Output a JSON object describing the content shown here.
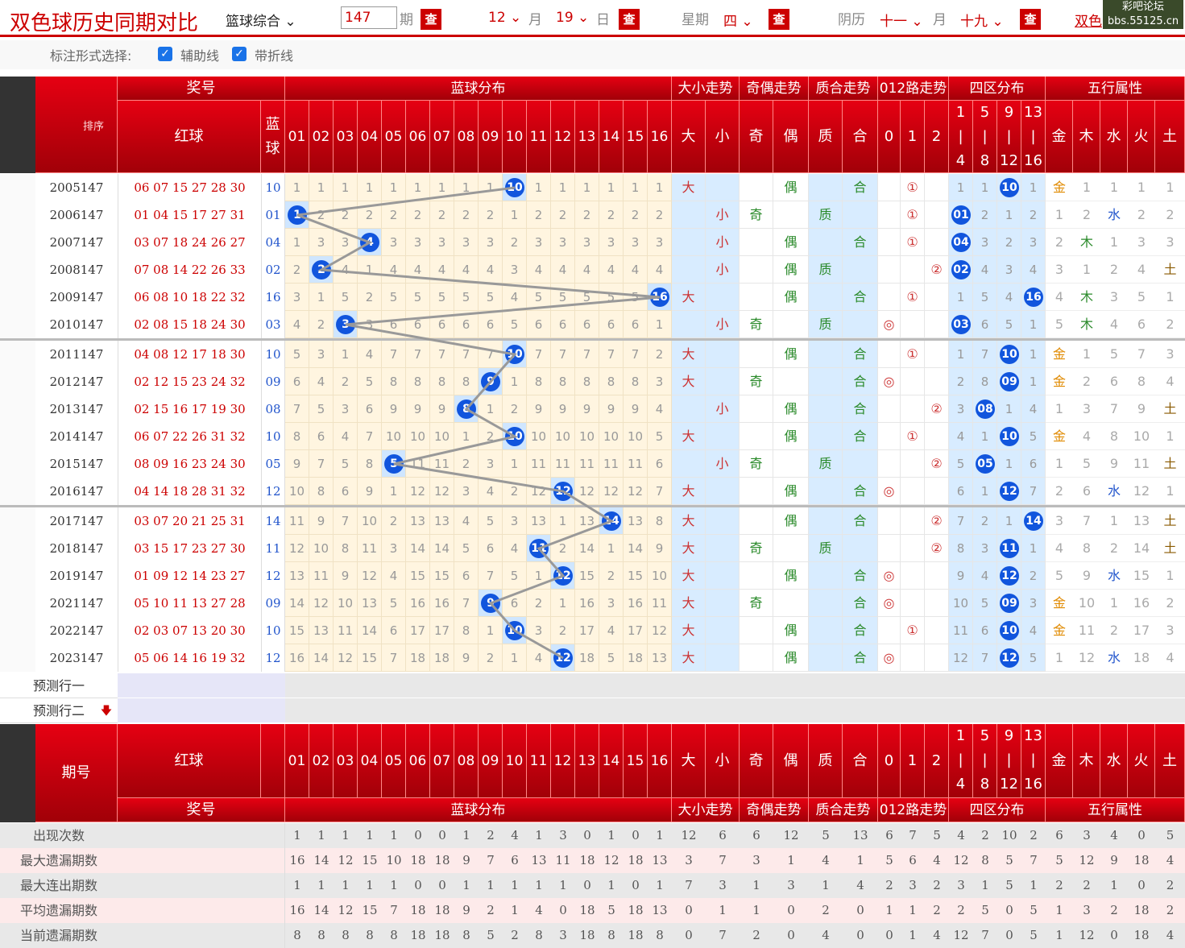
{
  "top": {
    "title": "双色球历史同期对比",
    "mode": "篮球综合",
    "issue_value": "147",
    "issue_unit": "期",
    "query": "查",
    "month": "12",
    "month_unit": "月",
    "day": "19",
    "day_unit": "日",
    "weekday_label": "星期",
    "weekday": "四",
    "lunar_label": "阴历",
    "lunar_month": "十一",
    "lunar_day": "十九",
    "site": "bbs.55125.cn",
    "brand": "彩吧论坛",
    "right_link": "双色"
  },
  "options": {
    "label": "标注形式选择:",
    "opt1": "辅助线",
    "opt2": "带折线"
  },
  "header": {
    "issue": "期号",
    "sort": "排序",
    "prize": "奖号",
    "red": "红球",
    "blue": "蓝球",
    "groups": [
      "蓝球分布",
      "大小走势",
      "奇偶走势",
      "质合走势",
      "012路走势",
      "四区分布",
      "五行属性"
    ],
    "blue_nums": [
      "01",
      "02",
      "03",
      "04",
      "05",
      "06",
      "07",
      "08",
      "09",
      "10",
      "11",
      "12",
      "13",
      "14",
      "15",
      "16"
    ],
    "dx": [
      "大",
      "小"
    ],
    "jo": [
      "奇",
      "偶"
    ],
    "zh": [
      "质",
      "合"
    ],
    "lu": [
      "0",
      "1",
      "2"
    ],
    "zone": [
      "1|4",
      "5|8",
      "9|12",
      "13|16"
    ],
    "wx": [
      "金",
      "木",
      "水",
      "火",
      "土"
    ]
  },
  "rows": [
    {
      "issue": "2005147",
      "red": "06 07 15 27 28 30",
      "blue": "10",
      "dist": [
        "1",
        "1",
        "1",
        "1",
        "1",
        "1",
        "1",
        "1",
        "1",
        "10",
        "1",
        "1",
        "1",
        "1",
        "1",
        "1"
      ],
      "dx": [
        "大",
        ""
      ],
      "jo": [
        "",
        "偶"
      ],
      "zh": [
        "",
        "合"
      ],
      "lu": [
        "",
        "①",
        ""
      ],
      "zone": [
        "1",
        "1",
        "10",
        "1"
      ],
      "wx": [
        "金",
        "1",
        "1",
        "1",
        "1"
      ]
    },
    {
      "issue": "2006147",
      "red": "01 04 15 17 27 31",
      "blue": "01",
      "dist": [
        "1",
        "2",
        "2",
        "2",
        "2",
        "2",
        "2",
        "2",
        "2",
        "1",
        "2",
        "2",
        "2",
        "2",
        "2",
        "2"
      ],
      "dx": [
        "",
        "小"
      ],
      "jo": [
        "奇",
        ""
      ],
      "zh": [
        "质",
        ""
      ],
      "lu": [
        "",
        "①",
        ""
      ],
      "zone": [
        "01",
        "2",
        "1",
        "2"
      ],
      "wx": [
        "1",
        "2",
        "水",
        "2",
        "2"
      ]
    },
    {
      "issue": "2007147",
      "red": "03 07 18 24 26 27",
      "blue": "04",
      "dist": [
        "1",
        "3",
        "3",
        "4",
        "3",
        "3",
        "3",
        "3",
        "3",
        "2",
        "3",
        "3",
        "3",
        "3",
        "3",
        "3"
      ],
      "dx": [
        "",
        "小"
      ],
      "jo": [
        "",
        "偶"
      ],
      "zh": [
        "",
        "合"
      ],
      "lu": [
        "",
        "①",
        ""
      ],
      "zone": [
        "04",
        "3",
        "2",
        "3"
      ],
      "wx": [
        "2",
        "木",
        "1",
        "3",
        "3"
      ]
    },
    {
      "issue": "2008147",
      "red": "07 08 14 22 26 33",
      "blue": "02",
      "dist": [
        "2",
        "2",
        "4",
        "1",
        "4",
        "4",
        "4",
        "4",
        "4",
        "3",
        "4",
        "4",
        "4",
        "4",
        "4",
        "4"
      ],
      "dx": [
        "",
        "小"
      ],
      "jo": [
        "",
        "偶"
      ],
      "zh": [
        "质",
        ""
      ],
      "lu": [
        "",
        "",
        "②"
      ],
      "zone": [
        "02",
        "4",
        "3",
        "4"
      ],
      "wx": [
        "3",
        "1",
        "2",
        "4",
        "土"
      ]
    },
    {
      "issue": "2009147",
      "red": "06 08 10 18 22 32",
      "blue": "16",
      "dist": [
        "3",
        "1",
        "5",
        "2",
        "5",
        "5",
        "5",
        "5",
        "5",
        "4",
        "5",
        "5",
        "5",
        "5",
        "5",
        "16"
      ],
      "dx": [
        "大",
        ""
      ],
      "jo": [
        "",
        "偶"
      ],
      "zh": [
        "",
        "合"
      ],
      "lu": [
        "",
        "①",
        ""
      ],
      "zone": [
        "1",
        "5",
        "4",
        "16"
      ],
      "wx": [
        "4",
        "木",
        "3",
        "5",
        "1"
      ]
    },
    {
      "issue": "2010147",
      "red": "02 08 15 18 24 30",
      "blue": "03",
      "dist": [
        "4",
        "2",
        "3",
        "3",
        "6",
        "6",
        "6",
        "6",
        "6",
        "5",
        "6",
        "6",
        "6",
        "6",
        "6",
        "1"
      ],
      "dx": [
        "",
        "小"
      ],
      "jo": [
        "奇",
        ""
      ],
      "zh": [
        "质",
        ""
      ],
      "lu": [
        "◎",
        "",
        ""
      ],
      "zone": [
        "03",
        "6",
        "5",
        "1"
      ],
      "wx": [
        "5",
        "木",
        "4",
        "6",
        "2"
      ]
    },
    {
      "issue": "2011147",
      "red": "04 08 12 17 18 30",
      "blue": "10",
      "dist": [
        "5",
        "3",
        "1",
        "4",
        "7",
        "7",
        "7",
        "7",
        "7",
        "10",
        "7",
        "7",
        "7",
        "7",
        "7",
        "2"
      ],
      "dx": [
        "大",
        ""
      ],
      "jo": [
        "",
        "偶"
      ],
      "zh": [
        "",
        "合"
      ],
      "lu": [
        "",
        "①",
        ""
      ],
      "zone": [
        "1",
        "7",
        "10",
        "1"
      ],
      "wx": [
        "金",
        "1",
        "5",
        "7",
        "3"
      ]
    },
    {
      "issue": "2012147",
      "red": "02 12 15 23 24 32",
      "blue": "09",
      "dist": [
        "6",
        "4",
        "2",
        "5",
        "8",
        "8",
        "8",
        "8",
        "9",
        "1",
        "8",
        "8",
        "8",
        "8",
        "8",
        "3"
      ],
      "dx": [
        "大",
        ""
      ],
      "jo": [
        "奇",
        ""
      ],
      "zh": [
        "",
        "合"
      ],
      "lu": [
        "◎",
        "",
        ""
      ],
      "zone": [
        "2",
        "8",
        "09",
        "1"
      ],
      "wx": [
        "金",
        "2",
        "6",
        "8",
        "4"
      ]
    },
    {
      "issue": "2013147",
      "red": "02 15 16 17 19 30",
      "blue": "08",
      "dist": [
        "7",
        "5",
        "3",
        "6",
        "9",
        "9",
        "9",
        "8",
        "1",
        "2",
        "9",
        "9",
        "9",
        "9",
        "9",
        "4"
      ],
      "dx": [
        "",
        "小"
      ],
      "jo": [
        "",
        "偶"
      ],
      "zh": [
        "",
        "合"
      ],
      "lu": [
        "",
        "",
        "②"
      ],
      "zone": [
        "3",
        "08",
        "1",
        "4"
      ],
      "wx": [
        "1",
        "3",
        "7",
        "9",
        "土"
      ]
    },
    {
      "issue": "2014147",
      "red": "06 07 22 26 31 32",
      "blue": "10",
      "dist": [
        "8",
        "6",
        "4",
        "7",
        "10",
        "10",
        "10",
        "1",
        "2",
        "10",
        "10",
        "10",
        "10",
        "10",
        "10",
        "5"
      ],
      "dx": [
        "大",
        ""
      ],
      "jo": [
        "",
        "偶"
      ],
      "zh": [
        "",
        "合"
      ],
      "lu": [
        "",
        "①",
        ""
      ],
      "zone": [
        "4",
        "1",
        "10",
        "5"
      ],
      "wx": [
        "金",
        "4",
        "8",
        "10",
        "1"
      ]
    },
    {
      "issue": "2015147",
      "red": "08 09 16 23 24 30",
      "blue": "05",
      "dist": [
        "9",
        "7",
        "5",
        "8",
        "5",
        "11",
        "11",
        "2",
        "3",
        "1",
        "11",
        "11",
        "11",
        "11",
        "11",
        "6"
      ],
      "dx": [
        "",
        "小"
      ],
      "jo": [
        "奇",
        ""
      ],
      "zh": [
        "质",
        ""
      ],
      "lu": [
        "",
        "",
        "②"
      ],
      "zone": [
        "5",
        "05",
        "1",
        "6"
      ],
      "wx": [
        "1",
        "5",
        "9",
        "11",
        "土"
      ]
    },
    {
      "issue": "2016147",
      "red": "04 14 18 28 31 32",
      "blue": "12",
      "dist": [
        "10",
        "8",
        "6",
        "9",
        "1",
        "12",
        "12",
        "3",
        "4",
        "2",
        "12",
        "12",
        "12",
        "12",
        "12",
        "7"
      ],
      "dx": [
        "大",
        ""
      ],
      "jo": [
        "",
        "偶"
      ],
      "zh": [
        "",
        "合"
      ],
      "lu": [
        "◎",
        "",
        ""
      ],
      "zone": [
        "6",
        "1",
        "12",
        "7"
      ],
      "wx": [
        "2",
        "6",
        "水",
        "12",
        "1"
      ]
    },
    {
      "issue": "2017147",
      "red": "03 07 20 21 25 31",
      "blue": "14",
      "dist": [
        "11",
        "9",
        "7",
        "10",
        "2",
        "13",
        "13",
        "4",
        "5",
        "3",
        "13",
        "1",
        "13",
        "14",
        "13",
        "8"
      ],
      "dx": [
        "大",
        ""
      ],
      "jo": [
        "",
        "偶"
      ],
      "zh": [
        "",
        "合"
      ],
      "lu": [
        "",
        "",
        "②"
      ],
      "zone": [
        "7",
        "2",
        "1",
        "14"
      ],
      "wx": [
        "3",
        "7",
        "1",
        "13",
        "土"
      ]
    },
    {
      "issue": "2018147",
      "red": "03 15 17 23 27 30",
      "blue": "11",
      "dist": [
        "12",
        "10",
        "8",
        "11",
        "3",
        "14",
        "14",
        "5",
        "6",
        "4",
        "11",
        "2",
        "14",
        "1",
        "14",
        "9"
      ],
      "dx": [
        "大",
        ""
      ],
      "jo": [
        "奇",
        ""
      ],
      "zh": [
        "质",
        ""
      ],
      "lu": [
        "",
        "",
        "②"
      ],
      "zone": [
        "8",
        "3",
        "11",
        "1"
      ],
      "wx": [
        "4",
        "8",
        "2",
        "14",
        "土"
      ]
    },
    {
      "issue": "2019147",
      "red": "01 09 12 14 23 27",
      "blue": "12",
      "dist": [
        "13",
        "11",
        "9",
        "12",
        "4",
        "15",
        "15",
        "6",
        "7",
        "5",
        "1",
        "12",
        "15",
        "2",
        "15",
        "10"
      ],
      "dx": [
        "大",
        ""
      ],
      "jo": [
        "",
        "偶"
      ],
      "zh": [
        "",
        "合"
      ],
      "lu": [
        "◎",
        "",
        ""
      ],
      "zone": [
        "9",
        "4",
        "12",
        "2"
      ],
      "wx": [
        "5",
        "9",
        "水",
        "15",
        "1"
      ]
    },
    {
      "issue": "2021147",
      "red": "05 10 11 13 27 28",
      "blue": "09",
      "dist": [
        "14",
        "12",
        "10",
        "13",
        "5",
        "16",
        "16",
        "7",
        "9",
        "6",
        "2",
        "1",
        "16",
        "3",
        "16",
        "11"
      ],
      "dx": [
        "大",
        ""
      ],
      "jo": [
        "奇",
        ""
      ],
      "zh": [
        "",
        "合"
      ],
      "lu": [
        "◎",
        "",
        ""
      ],
      "zone": [
        "10",
        "5",
        "09",
        "3"
      ],
      "wx": [
        "金",
        "10",
        "1",
        "16",
        "2"
      ]
    },
    {
      "issue": "2022147",
      "red": "02 03 07 13 20 30",
      "blue": "10",
      "dist": [
        "15",
        "13",
        "11",
        "14",
        "6",
        "17",
        "17",
        "8",
        "1",
        "10",
        "3",
        "2",
        "17",
        "4",
        "17",
        "12"
      ],
      "dx": [
        "大",
        ""
      ],
      "jo": [
        "",
        "偶"
      ],
      "zh": [
        "",
        "合"
      ],
      "lu": [
        "",
        "①",
        ""
      ],
      "zone": [
        "11",
        "6",
        "10",
        "4"
      ],
      "wx": [
        "金",
        "11",
        "2",
        "17",
        "3"
      ]
    },
    {
      "issue": "2023147",
      "red": "05 06 14 16 19 32",
      "blue": "12",
      "dist": [
        "16",
        "14",
        "12",
        "15",
        "7",
        "18",
        "18",
        "9",
        "2",
        "1",
        "4",
        "12",
        "18",
        "5",
        "18",
        "13"
      ],
      "dx": [
        "大",
        ""
      ],
      "jo": [
        "",
        "偶"
      ],
      "zh": [
        "",
        "合"
      ],
      "lu": [
        "◎",
        "",
        ""
      ],
      "zone": [
        "12",
        "7",
        "12",
        "5"
      ],
      "wx": [
        "1",
        "12",
        "水",
        "18",
        "4"
      ]
    }
  ],
  "predict": [
    "预测行一",
    "预测行二"
  ],
  "stats": [
    {
      "label": "出现次数",
      "v": [
        "1",
        "1",
        "1",
        "1",
        "1",
        "0",
        "0",
        "1",
        "2",
        "4",
        "1",
        "3",
        "0",
        "1",
        "0",
        "1",
        "12",
        "6",
        "6",
        "12",
        "5",
        "13",
        "6",
        "7",
        "5",
        "4",
        "2",
        "10",
        "2",
        "6",
        "3",
        "4",
        "0",
        "5"
      ]
    },
    {
      "label": "最大遗漏期数",
      "v": [
        "16",
        "14",
        "12",
        "15",
        "10",
        "18",
        "18",
        "9",
        "7",
        "6",
        "13",
        "11",
        "18",
        "12",
        "18",
        "13",
        "3",
        "7",
        "3",
        "1",
        "4",
        "1",
        "5",
        "6",
        "4",
        "12",
        "8",
        "5",
        "7",
        "5",
        "12",
        "9",
        "18",
        "4"
      ]
    },
    {
      "label": "最大连出期数",
      "v": [
        "1",
        "1",
        "1",
        "1",
        "1",
        "0",
        "0",
        "1",
        "1",
        "1",
        "1",
        "1",
        "0",
        "1",
        "0",
        "1",
        "7",
        "3",
        "1",
        "3",
        "1",
        "4",
        "2",
        "3",
        "2",
        "3",
        "1",
        "5",
        "1",
        "2",
        "2",
        "1",
        "0",
        "2"
      ]
    },
    {
      "label": "平均遗漏期数",
      "v": [
        "16",
        "14",
        "12",
        "15",
        "7",
        "18",
        "18",
        "9",
        "2",
        "1",
        "4",
        "0",
        "18",
        "5",
        "18",
        "13",
        "0",
        "1",
        "1",
        "0",
        "2",
        "0",
        "1",
        "1",
        "2",
        "2",
        "5",
        "0",
        "5",
        "1",
        "3",
        "2",
        "18",
        "2"
      ]
    },
    {
      "label": "当前遗漏期数",
      "v": [
        "8",
        "8",
        "8",
        "8",
        "8",
        "18",
        "18",
        "8",
        "5",
        "2",
        "8",
        "3",
        "18",
        "8",
        "18",
        "8",
        "0",
        "7",
        "2",
        "0",
        "4",
        "0",
        "0",
        "1",
        "4",
        "12",
        "7",
        "0",
        "5",
        "1",
        "12",
        "0",
        "18",
        "4"
      ]
    }
  ],
  "colors": {
    "red": "#c00",
    "blue_ball": "#1155dd",
    "header": "#d6000f"
  }
}
